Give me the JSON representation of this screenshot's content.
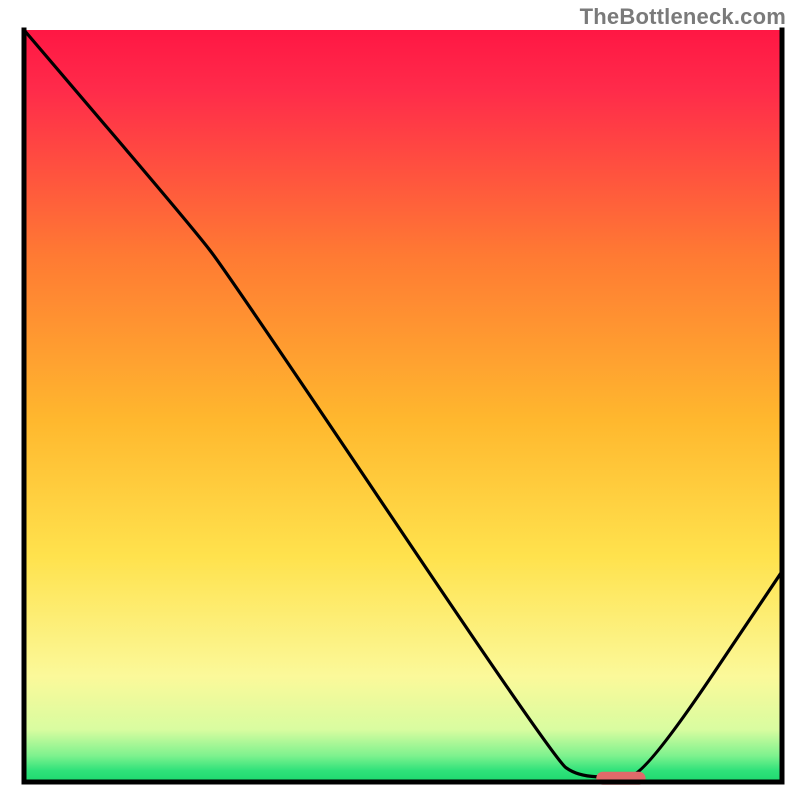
{
  "watermark": "TheBottleneck.com",
  "chart_data": {
    "type": "line",
    "title": "",
    "xlabel": "",
    "ylabel": "",
    "xlim": [
      0,
      100
    ],
    "ylim": [
      0,
      100
    ],
    "gradient_stops": [
      {
        "offset": 0.0,
        "color": "#ff1744"
      },
      {
        "offset": 0.08,
        "color": "#ff2b4a"
      },
      {
        "offset": 0.3,
        "color": "#ff7a33"
      },
      {
        "offset": 0.52,
        "color": "#ffb82e"
      },
      {
        "offset": 0.7,
        "color": "#ffe24d"
      },
      {
        "offset": 0.86,
        "color": "#fbf99a"
      },
      {
        "offset": 0.93,
        "color": "#d9fca0"
      },
      {
        "offset": 0.965,
        "color": "#7ef28e"
      },
      {
        "offset": 0.985,
        "color": "#2fe27a"
      },
      {
        "offset": 1.0,
        "color": "#1dd96f"
      }
    ],
    "curve_points": [
      {
        "x": 0.0,
        "y": 100.0
      },
      {
        "x": 22.0,
        "y": 74.0
      },
      {
        "x": 27.0,
        "y": 67.5
      },
      {
        "x": 70.0,
        "y": 3.0
      },
      {
        "x": 73.0,
        "y": 0.8
      },
      {
        "x": 78.0,
        "y": 0.6
      },
      {
        "x": 82.0,
        "y": 1.0
      },
      {
        "x": 100.0,
        "y": 28.0
      }
    ],
    "optimal_marker": {
      "x_start": 75.5,
      "x_end": 82.0,
      "y": 0.5,
      "color": "#e06a6a"
    },
    "frame": {
      "stroke": "#000000",
      "width": 5
    }
  }
}
